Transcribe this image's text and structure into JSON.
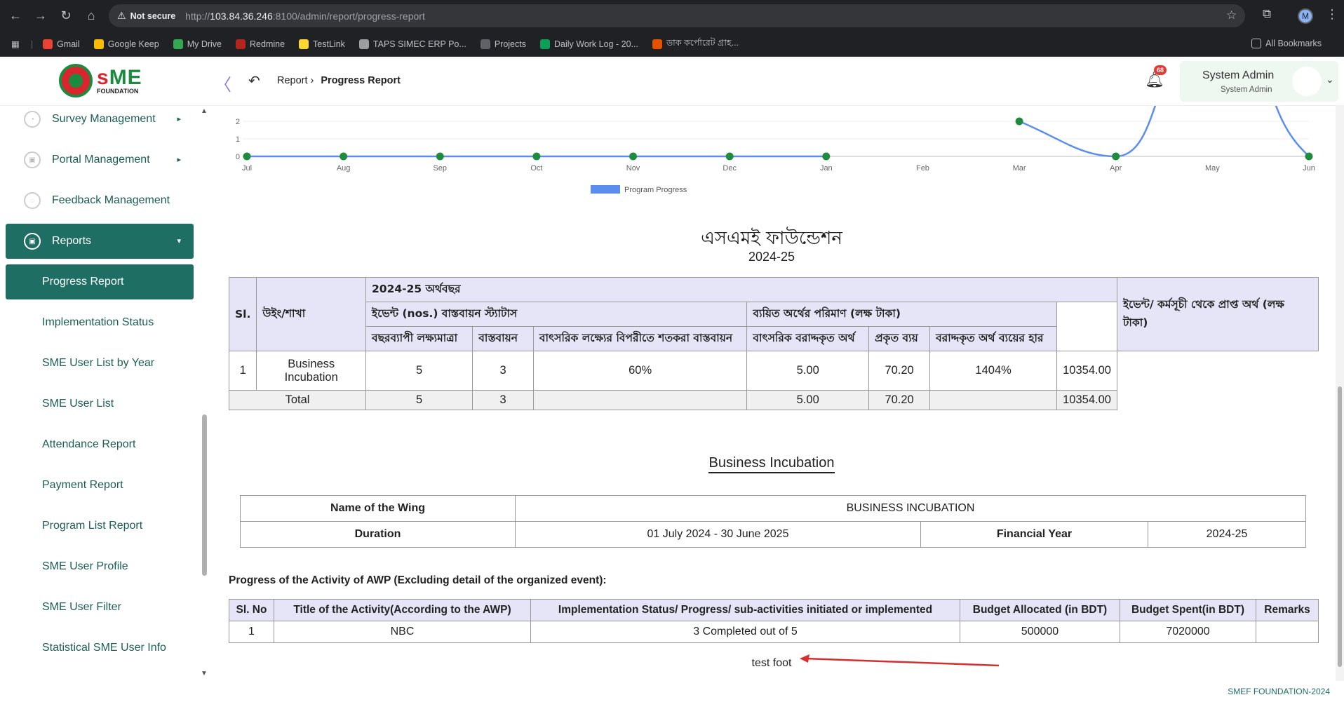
{
  "browser": {
    "security_label": "Not secure",
    "url_prefix": "http://",
    "url_host": "103.84.36.246",
    "url_rest": ":8100/admin/report/progress-report",
    "profile_initial": "M",
    "bookmarks": [
      {
        "label": "Gmail",
        "color": "#ea4335"
      },
      {
        "label": "Google Keep",
        "color": "#fbbc04"
      },
      {
        "label": "My Drive",
        "color": "#34a853"
      },
      {
        "label": "Redmine",
        "color": "#b3261e"
      },
      {
        "label": "TestLink",
        "color": "#fdd835"
      },
      {
        "label": "TAPS SIMEC ERP Po...",
        "color": "#9e9e9e"
      },
      {
        "label": "Projects",
        "color": "#5f6368"
      },
      {
        "label": "Daily Work Log - 20...",
        "color": "#0f9d58"
      },
      {
        "label": "ডাক কর্পোরেট গ্রাহ...",
        "color": "#e65100"
      }
    ],
    "all_bookmarks": "All Bookmarks"
  },
  "header": {
    "logo_text": "FOUNDATION",
    "breadcrumb_parent": "Report",
    "breadcrumb_current": "Progress Report",
    "notification_count": "68",
    "user_name": "System Admin",
    "user_role": "System Admin"
  },
  "sidebar": {
    "items": [
      {
        "label": "Survey Management"
      },
      {
        "label": "Portal Management"
      },
      {
        "label": "Feedback Management"
      },
      {
        "label": "Reports"
      }
    ],
    "sub_items": [
      {
        "label": "Progress Report"
      },
      {
        "label": "Implementation Status"
      },
      {
        "label": "SME User List by Year"
      },
      {
        "label": "SME User List"
      },
      {
        "label": "Attendance Report"
      },
      {
        "label": "Payment Report"
      },
      {
        "label": "Program List Report"
      },
      {
        "label": "SME User Profile"
      },
      {
        "label": "SME User Filter"
      },
      {
        "label": "Statistical SME User Info"
      }
    ]
  },
  "chart_data": {
    "type": "line",
    "x": [
      "Jul",
      "Aug",
      "Sep",
      "Oct",
      "Nov",
      "Dec",
      "Jan",
      "Feb",
      "Mar",
      "Apr",
      "May",
      "Jun"
    ],
    "series": [
      {
        "name": "Program Progress",
        "values": [
          0,
          0,
          0,
          0,
          0,
          0,
          0,
          null,
          2,
          0,
          null,
          0
        ]
      }
    ],
    "y_ticks_visible": [
      "0",
      "1",
      "2"
    ],
    "legend": "Program Progress",
    "legend_position": "bottom-center",
    "color": "#5b8def",
    "point_color": "#1e8b3f"
  },
  "report": {
    "org_name": "এসএমই ফাউন্ডেশন",
    "fiscal_year": "2024-25",
    "summary": {
      "col_sl": "Sl.",
      "col_wing": "উইং/শাখা",
      "group_fy": "2024-25 অর্থবছর",
      "group_events": "ইভেন্ট (nos.) বাস্তবায়ন স্ট্যাটাস",
      "group_funds": "ব্যয়িত অর্থের পরিমাণ (লক্ষ টাকা)",
      "col_income": "ইভেন্ট/ কর্মসূচী থেকে প্রাপ্ত অর্থ (লক্ষ টাকা)",
      "col_annual_target": "বছরব্যাপী লক্ষ্যমাত্রা",
      "col_implemented": "বাস্তবায়ন",
      "col_percent": "বাৎসরিক লক্ষ্যের বিপরীতে শতকরা বাস্তবায়ন",
      "col_allocated": "বাৎসরিক বরাদ্দকৃত অর্থ",
      "col_actual": "প্রকৃত ব্যয়",
      "col_rate": "বরাদ্দকৃত অর্থ ব্যয়ের হার",
      "row": {
        "sl": "1",
        "wing": "Business Incubation",
        "target": "5",
        "implemented": "3",
        "percent": "60%",
        "allocated": "5.00",
        "actual": "70.20",
        "rate": "1404%",
        "income": "10354.00"
      },
      "total": {
        "label": "Total",
        "target": "5",
        "implemented": "3",
        "allocated": "5.00",
        "actual": "70.20",
        "income": "10354.00"
      }
    },
    "section_title": "Business Incubation",
    "wing_info": {
      "wing_label": "Name of the Wing",
      "wing_value": "BUSINESS INCUBATION",
      "duration_label": "Duration",
      "duration_value": "01 July 2024 - 30 June 2025",
      "fy_label": "Financial Year",
      "fy_value": "2024-25"
    },
    "awp_title": "Progress of the Activity of AWP (Excluding detail of the organized event):",
    "awp_headers": [
      "Sl. No",
      "Title of the Activity(According to the AWP)",
      "Implementation Status/ Progress/ sub-activities initiated or implemented",
      "Budget Allocated (in BDT)",
      "Budget Spent(in BDT)",
      "Remarks"
    ],
    "awp_row": {
      "sl": "1",
      "title": "NBC",
      "status": "3 Completed out of 5",
      "allocated": "500000",
      "spent": "7020000",
      "remarks": ""
    },
    "footer_note": "test foot"
  },
  "footer": {
    "text": "SMEF FOUNDATION-2024"
  }
}
